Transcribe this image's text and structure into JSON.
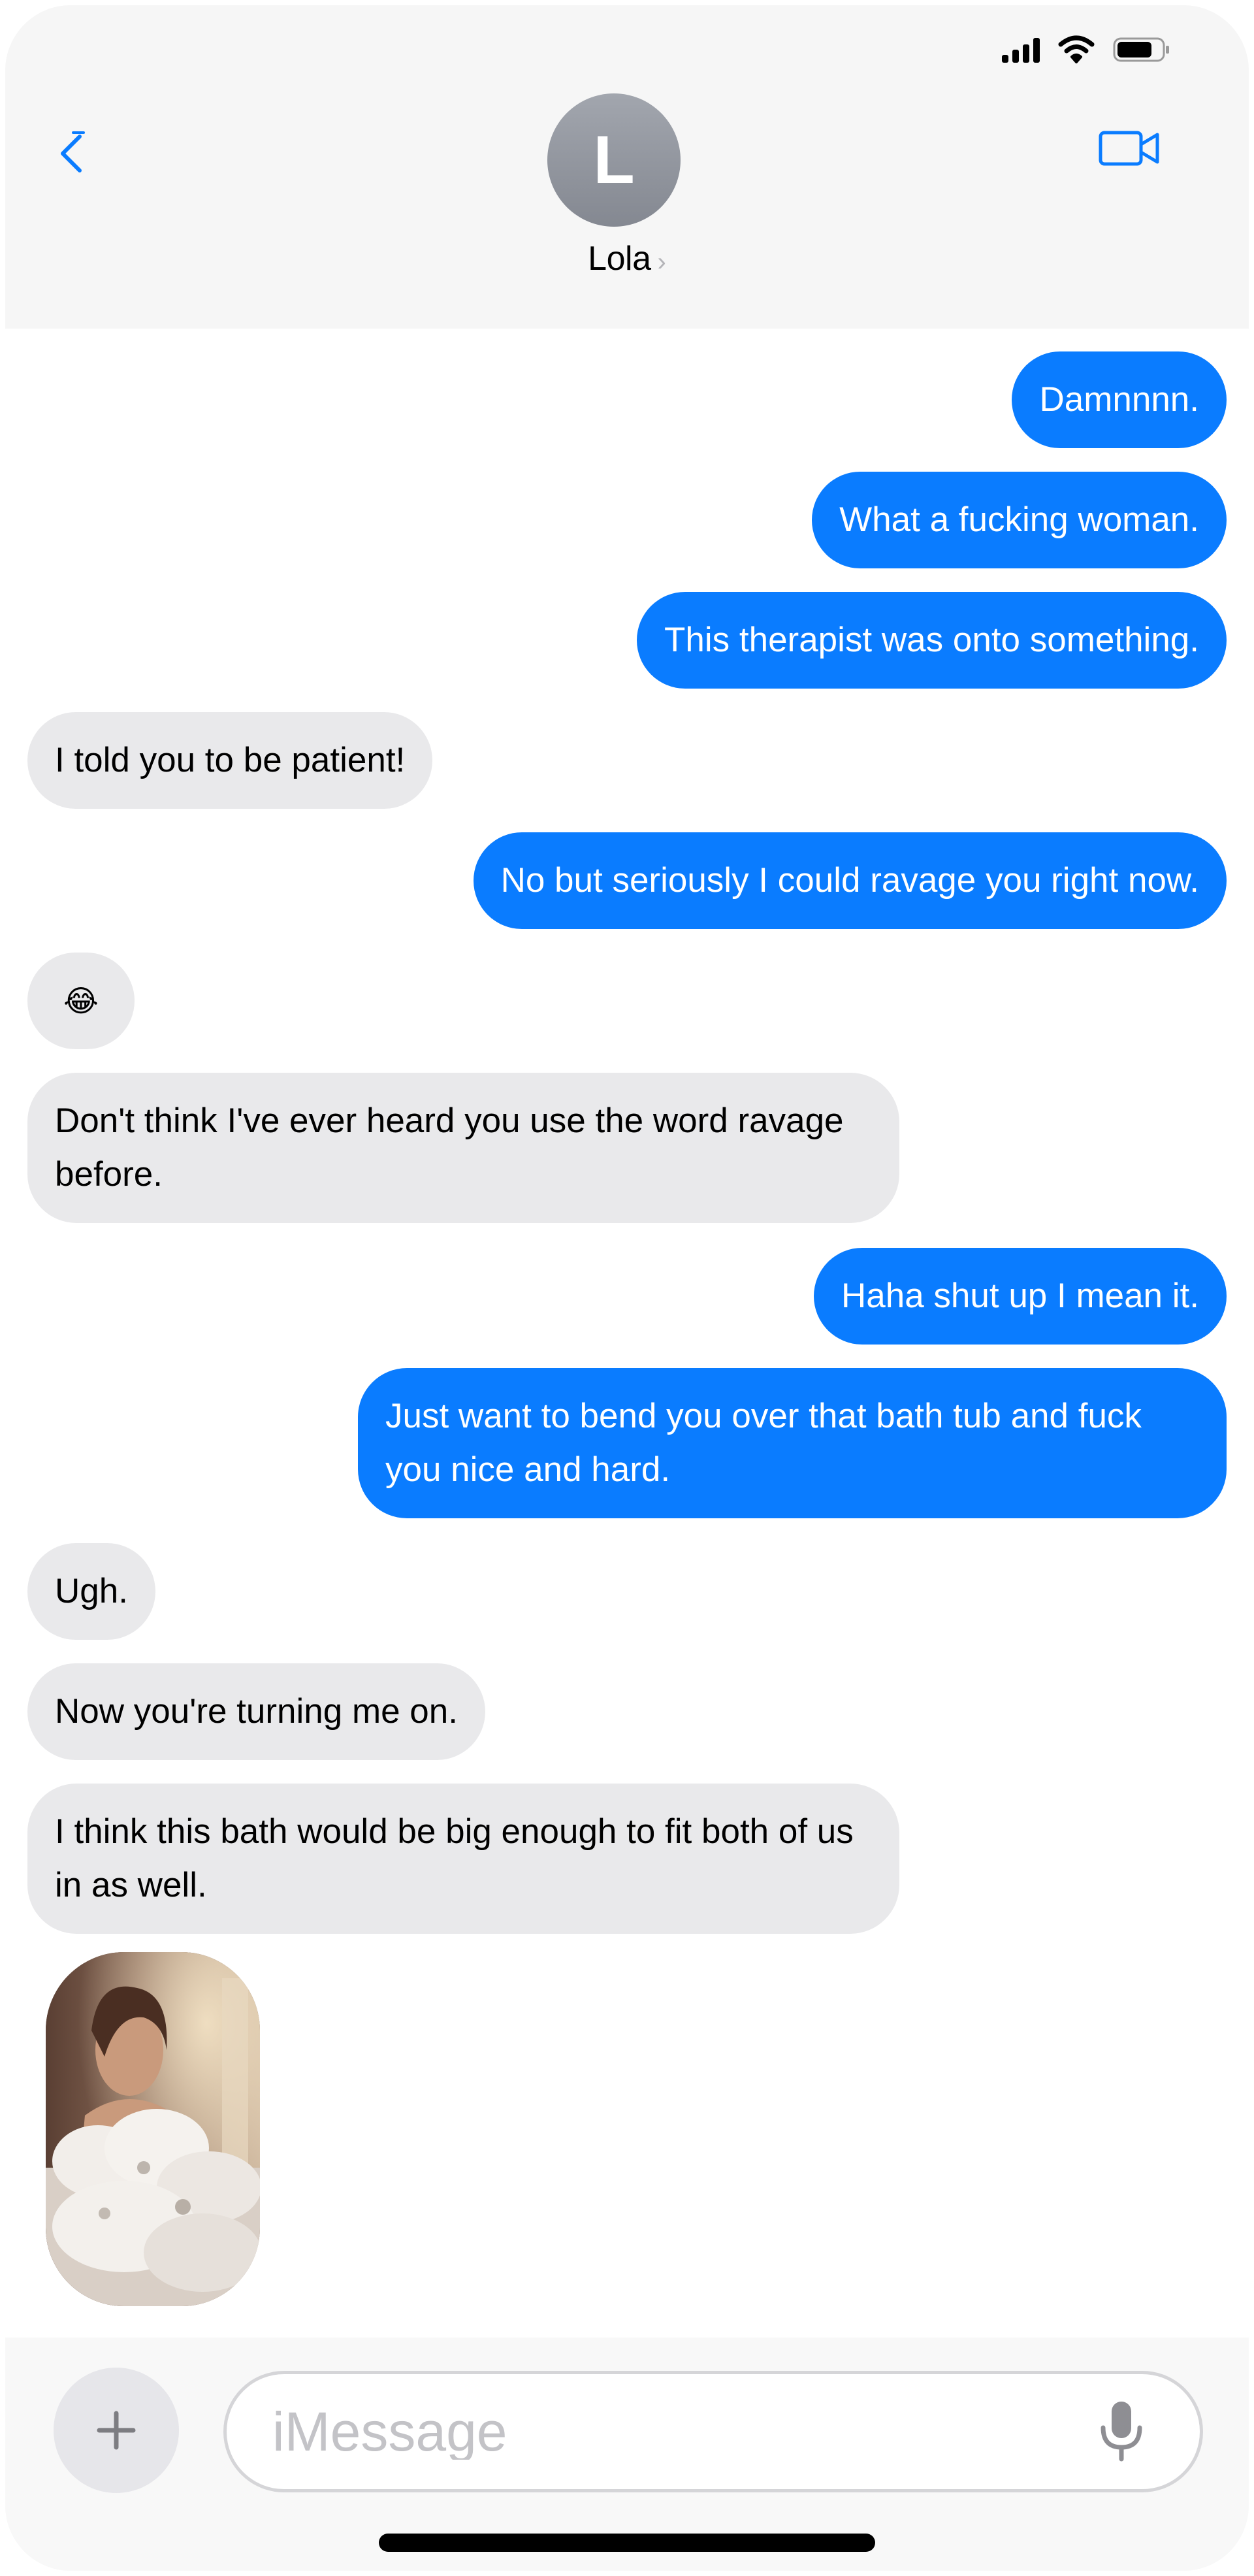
{
  "header": {
    "contact_initial": "L",
    "contact_name": "Lola"
  },
  "messages": [
    {
      "side": "sent",
      "text": "Damnnnn."
    },
    {
      "side": "sent",
      "text": "What a fucking woman."
    },
    {
      "side": "sent",
      "text": "This therapist was onto something."
    },
    {
      "side": "received",
      "text": "I told you to be patient!"
    },
    {
      "side": "sent",
      "text": "No but seriously I could ravage you right now."
    },
    {
      "side": "received",
      "text": "😂"
    },
    {
      "side": "received",
      "text": "Don't think I've ever heard you use the word ravage before."
    },
    {
      "side": "sent",
      "text": "Haha shut up I mean it."
    },
    {
      "side": "sent",
      "text": "Just want to bend you over that bath tub and fuck you nice and hard."
    },
    {
      "side": "received",
      "text": "Ugh."
    },
    {
      "side": "received",
      "text": "Now you're turning me on."
    },
    {
      "side": "received",
      "text": "I think this bath would be big enough to fit both of us in as well."
    }
  ],
  "input": {
    "placeholder": "iMessage"
  },
  "colors": {
    "sent_bubble": "#0a7cff",
    "received_bubble": "#e9e9eb",
    "accent": "#0a7cff",
    "header_bg": "#f6f6f6"
  },
  "icons": [
    "back-chevron-icon",
    "video-camera-icon",
    "cellular-signal-icon",
    "wifi-icon",
    "battery-icon",
    "plus-icon",
    "microphone-icon"
  ]
}
